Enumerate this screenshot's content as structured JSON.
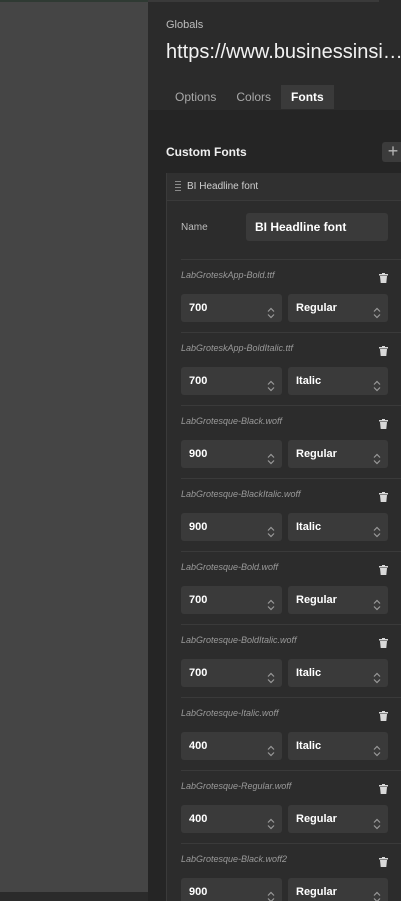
{
  "header": {
    "section_label": "Globals",
    "url_title": "https://www.businessinsider.com"
  },
  "tabs": [
    {
      "label": "Options",
      "active": false
    },
    {
      "label": "Colors",
      "active": false
    },
    {
      "label": "Fonts",
      "active": true
    }
  ],
  "custom_fonts": {
    "title": "Custom Fonts",
    "add_icon": "plus-icon",
    "card_title": "BI Headline font",
    "name_label": "Name",
    "name_value": "BI Headline font",
    "files": [
      {
        "file": "LabGroteskApp-Bold.ttf",
        "weight": "700",
        "style": "Regular"
      },
      {
        "file": "LabGroteskApp-BoldItalic.ttf",
        "weight": "700",
        "style": "Italic"
      },
      {
        "file": "LabGrotesque-Black.woff",
        "weight": "900",
        "style": "Regular"
      },
      {
        "file": "LabGrotesque-BlackItalic.woff",
        "weight": "900",
        "style": "Italic"
      },
      {
        "file": "LabGrotesque-Bold.woff",
        "weight": "700",
        "style": "Regular"
      },
      {
        "file": "LabGrotesque-BoldItalic.woff",
        "weight": "700",
        "style": "Italic"
      },
      {
        "file": "LabGrotesque-Italic.woff",
        "weight": "400",
        "style": "Italic"
      },
      {
        "file": "LabGrotesque-Regular.woff",
        "weight": "400",
        "style": "Regular"
      },
      {
        "file": "LabGrotesque-Black.woff2",
        "weight": "900",
        "style": "Regular"
      }
    ]
  }
}
